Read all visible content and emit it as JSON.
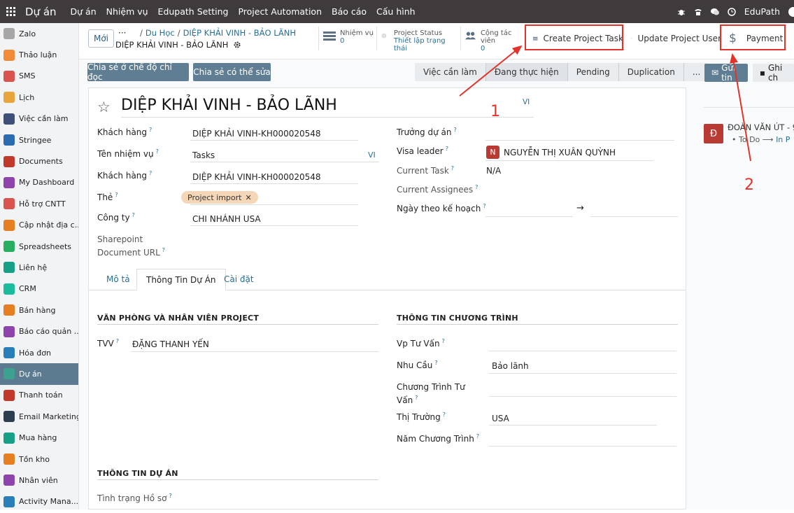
{
  "topbar": {
    "brand": "Dự án",
    "menu": [
      "Dự án",
      "Nhiệm vụ",
      "Edupath Setting",
      "Project Automation",
      "Báo cáo",
      "Cấu hình"
    ],
    "user": "EduPath"
  },
  "sidebar": {
    "items": [
      {
        "label": "Zalo",
        "color": "#a6a6a6"
      },
      {
        "label": "Thảo luận",
        "color": "#f28a3a"
      },
      {
        "label": "SMS",
        "color": "#d9534f"
      },
      {
        "label": "Lịch",
        "color": "#e8a53c"
      },
      {
        "label": "Việc cần làm",
        "color": "#3e4f78"
      },
      {
        "label": "Stringee",
        "color": "#2b6cb0"
      },
      {
        "label": "Documents",
        "color": "#c0392b"
      },
      {
        "label": "My Dashboard",
        "color": "#8e44ad"
      },
      {
        "label": "Hỗ trợ CNTT",
        "color": "#d9534f"
      },
      {
        "label": "Cập nhật địa c...",
        "color": "#e67e22"
      },
      {
        "label": "Spreadsheets",
        "color": "#27ae60"
      },
      {
        "label": "Liên hệ",
        "color": "#16a085"
      },
      {
        "label": "CRM",
        "color": "#1abc9c"
      },
      {
        "label": "Bán hàng",
        "color": "#e67e22"
      },
      {
        "label": "Báo cáo quản ...",
        "color": "#8e44ad"
      },
      {
        "label": "Hóa đơn",
        "color": "#2980b9"
      },
      {
        "label": "Dự án",
        "color": "#3ca28f"
      },
      {
        "label": "Thanh toán",
        "color": "#c0392b"
      },
      {
        "label": "Email Marketing",
        "color": "#2c3e50"
      },
      {
        "label": "Mua hàng",
        "color": "#16a085"
      },
      {
        "label": "Tồn kho",
        "color": "#e67e22"
      },
      {
        "label": "Nhân viên",
        "color": "#8e44ad"
      },
      {
        "label": "Activity Mana...",
        "color": "#2980b9"
      }
    ],
    "active_index": 16
  },
  "control_panel": {
    "new_button": "Mới",
    "breadcrumb_dots": "···",
    "breadcrumb_sep": "/",
    "breadcrumb_parent": "Du Học",
    "breadcrumb_current": "DIỆP KHẢI VINH - BẢO LÃNH",
    "record_name": "DIỆP KHẢI VINH - BẢO LÃNH",
    "stat_tasks": {
      "label": "Nhiệm vụ",
      "value": "0"
    },
    "stat_status": {
      "label": "Project Status",
      "value": "Thiết lập trạng thái"
    },
    "stat_collab": {
      "label": "Cộng tác viên",
      "value": "0"
    },
    "btn_create_task": "Create Project Task",
    "btn_update_user": "Update Project User",
    "btn_payment": "Payment"
  },
  "actions": {
    "share_readonly": "Chia sẻ ở chế độ chỉ đọc",
    "share_edit": "Chia sẻ có thể sửa",
    "stages": [
      "Việc cần làm",
      "Đang thực hiện",
      "Pending",
      "Duplication",
      "..."
    ],
    "active_stage": "Đang thực hiện",
    "send_message": "Gửi tin",
    "log_note": "Ghi ch"
  },
  "form": {
    "title": "DIỆP KHẢI VINH - BẢO LÃNH",
    "lang": "VI",
    "customer_label": "Khách hàng",
    "customer_value": "DIỆP KHẢI VINH-KH000020548",
    "task_name_label": "Tên nhiệm vụ",
    "task_name_value": "Tasks",
    "customer2_label": "Khách hàng",
    "customer2_value": "DIỆP KHẢI VINH-KH000020548",
    "tag_label": "Thẻ",
    "tag_value": "Project import",
    "company_label": "Công ty",
    "company_value": "CHI NHÁNH USA",
    "sharepoint_label": "Sharepoint Document URL",
    "manager_label": "Trưởng dự án",
    "visa_leader_label": "Visa leader",
    "visa_leader_initial": "N",
    "visa_leader_value": "NGUYỄN THỊ XUÂN QUỲNH",
    "current_task_label": "Current Task",
    "current_task_value": "N/A",
    "current_assignees_label": "Current Assignees",
    "planned_date_label": "Ngày theo kế hoạch",
    "date_arrow": "→",
    "help": "?"
  },
  "tabs": [
    "Mô tả",
    "Thông Tin Dự Án",
    "Cài đặt"
  ],
  "active_tab": "Thông Tin Dự Án",
  "project_info": {
    "office_section": "VĂN PHÒNG VÀ NHÂN VIÊN PROJECT",
    "tvv_label": "TVV",
    "tvv_value": "ĐẶNG THANH YẾN",
    "program_section": "THÔNG TIN CHƯƠNG TRÌNH",
    "vp_label": "Vp Tư Vấn",
    "need_label": "Nhu Cầu",
    "need_value": "Bảo lãnh",
    "program_label": "Chương Trình Tư Vấn",
    "market_label": "Thị Trường",
    "market_value": "USA",
    "year_label": "Năm Chương Trình",
    "project_section": "THÔNG TIN DỰ ÁN",
    "file_status_label": "Tình trạng Hồ sơ"
  },
  "chatter": {
    "avatar_initial": "Đ",
    "author": "ĐOÀN VĂN ÚT - 9",
    "activity_from": "To Do",
    "activity_arrow": "⟶",
    "activity_to": "In P"
  },
  "annotations": {
    "label_1": "1",
    "label_2": "2",
    "color": "#e2332b"
  }
}
